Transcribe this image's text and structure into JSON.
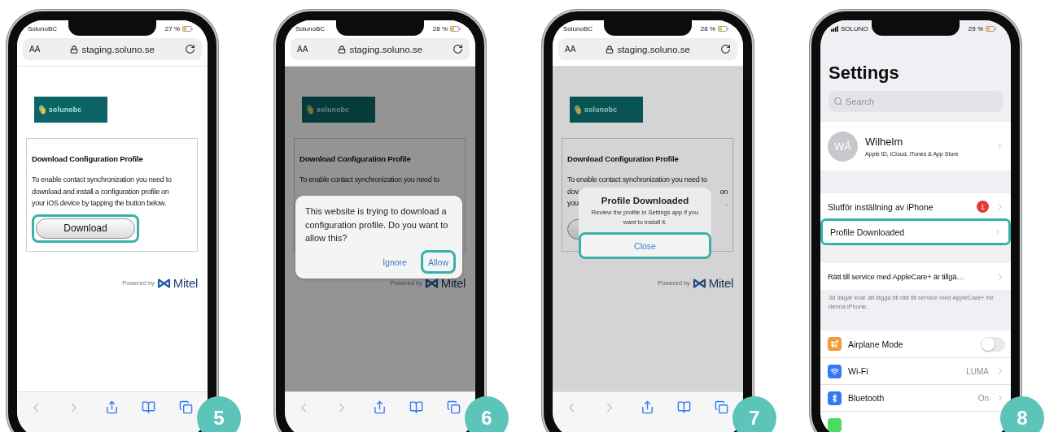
{
  "phones": [
    {
      "step": "5",
      "kind": "browser",
      "status": {
        "carrier": "SolunoBC",
        "battery": "27 %"
      },
      "browser": {
        "text_size": "AA",
        "url": "staging.soluno.se"
      },
      "page": {
        "logo": "solunobc",
        "heading": "Download Configuration Profile",
        "lines": [
          {
            "left": "To enable contact synchronization you need to"
          },
          {
            "left": "download and install a configuration profile on"
          },
          {
            "left": "your iOS device by tapping the button below."
          }
        ],
        "button": {
          "kind": "labeled",
          "label": "Download",
          "highlighted": true
        },
        "powered_by": "Powered by",
        "brand": "Mitel"
      }
    },
    {
      "step": "6",
      "kind": "browser",
      "status": {
        "carrier": "SolunoBC",
        "battery": "28 %"
      },
      "browser": {
        "text_size": "AA",
        "url": "staging.soluno.se"
      },
      "page": {
        "logo": "solunobc",
        "heading": "Download Configuration Profile",
        "lines": [
          {
            "left": "To enable contact synchronization you need to"
          }
        ],
        "powered_by": "Powered by",
        "brand": "Mitel"
      },
      "dialog": {
        "kind": "prompt",
        "message": "This website is trying to download a configuration profile. Do you want to allow this?",
        "actions": [
          {
            "label": "Ignore",
            "highlighted": false
          },
          {
            "label": "Allow",
            "highlighted": true
          }
        ]
      }
    },
    {
      "step": "7",
      "kind": "browser",
      "status": {
        "carrier": "SolunoBC",
        "battery": "28 %"
      },
      "browser": {
        "text_size": "AA",
        "url": "staging.soluno.se"
      },
      "page": {
        "logo": "solunobc",
        "heading": "Download Configuration Profile",
        "lines": [
          {
            "left": "To enable contact synchronization you need to"
          },
          {
            "left": "dov",
            "right": "on"
          },
          {
            "left": "you",
            "right": "."
          }
        ],
        "button": {
          "kind": "covered"
        },
        "powered_by": "Powered by",
        "brand": "Mitel"
      },
      "dialog": {
        "kind": "alert",
        "title": "Profile Downloaded",
        "message": "Review the profile in Settings app if you want to install it.",
        "actions": [
          {
            "label": "Close",
            "highlighted": true
          }
        ]
      }
    },
    {
      "step": "8",
      "kind": "settings",
      "status": {
        "carrier": "SOLUNO",
        "battery": "29 %"
      },
      "settings": {
        "title": "Settings",
        "search": {
          "placeholder": "Search"
        },
        "account": {
          "initials": "WÅ",
          "name": "Wilhelm",
          "subtitle": "Apple ID, iCloud, iTunes & App Store"
        },
        "groups": [
          {
            "rows": [
              {
                "kind": "nav",
                "label": "Slutför inställning av iPhone",
                "badge": "1",
                "highlighted": false
              },
              {
                "kind": "nav",
                "label": "Profile Downloaded",
                "highlighted": true
              }
            ]
          },
          {
            "rows": [
              {
                "kind": "nav",
                "label": "Rätt till service med AppleCare+ är tillgä…",
                "highlighted": false
              }
            ],
            "footer": "38 dagar kvar att lägga till rätt till service med AppleCare+ för denna iPhone."
          },
          {
            "rows": [
              {
                "kind": "toggle",
                "label": "Airplane Mode",
                "color": "#f19a37",
                "on": false,
                "highlighted": false
              },
              {
                "kind": "nav",
                "label": "Wi-Fi",
                "value": "LUMA",
                "color": "#3478f6",
                "highlighted": false
              },
              {
                "kind": "nav",
                "label": "Bluetooth",
                "value": "On",
                "color": "#3478f6",
                "highlighted": false
              },
              {
                "kind": "cut",
                "color": "#4cd964",
                "highlighted": false
              }
            ]
          }
        ]
      }
    }
  ]
}
